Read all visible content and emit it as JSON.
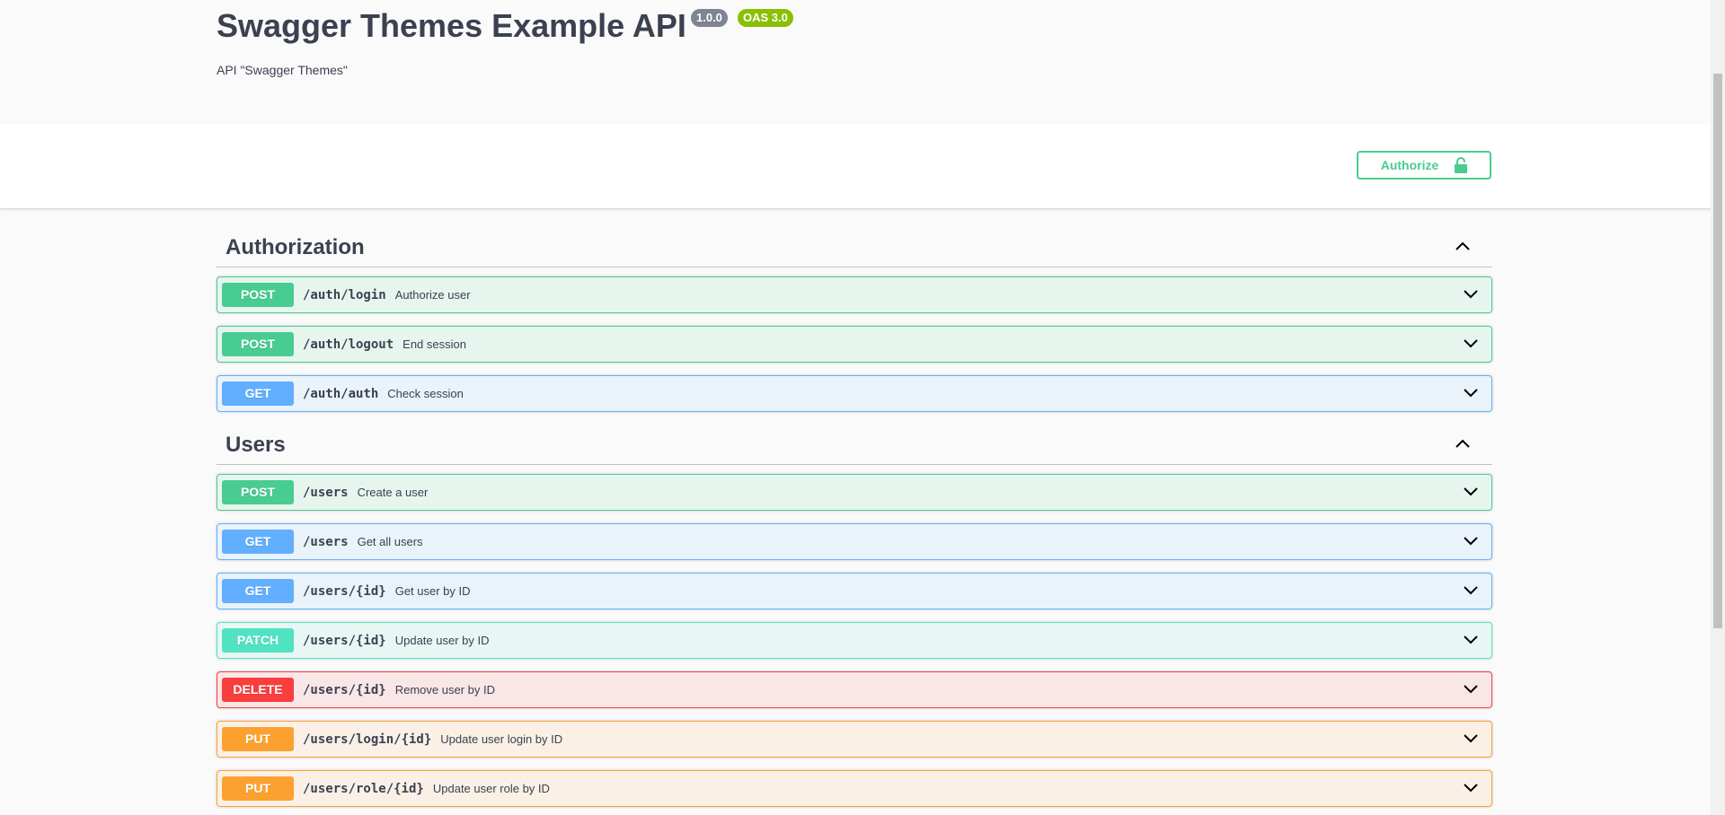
{
  "info": {
    "title": "Swagger Themes Example API",
    "version_badge": "1.0.0",
    "oas_badge": "OAS 3.0",
    "description": "API \"Swagger Themes\""
  },
  "authorize": {
    "label": "Authorize",
    "icon": "lock-icon"
  },
  "tags": [
    {
      "name": "Authorization",
      "operations": [
        {
          "method": "POST",
          "path": "/auth/login",
          "summary": "Authorize user"
        },
        {
          "method": "POST",
          "path": "/auth/logout",
          "summary": "End session"
        },
        {
          "method": "GET",
          "path": "/auth/auth",
          "summary": "Check session"
        }
      ]
    },
    {
      "name": "Users",
      "operations": [
        {
          "method": "POST",
          "path": "/users",
          "summary": "Create a user"
        },
        {
          "method": "GET",
          "path": "/users",
          "summary": "Get all users"
        },
        {
          "method": "GET",
          "path": "/users/{id}",
          "summary": "Get user by ID"
        },
        {
          "method": "PATCH",
          "path": "/users/{id}",
          "summary": "Update user by ID"
        },
        {
          "method": "DELETE",
          "path": "/users/{id}",
          "summary": "Remove user by ID"
        },
        {
          "method": "PUT",
          "path": "/users/login/{id}",
          "summary": "Update user login by ID"
        },
        {
          "method": "PUT",
          "path": "/users/role/{id}",
          "summary": "Update user role by ID"
        }
      ]
    }
  ],
  "colors": {
    "post": "#49cc90",
    "get": "#61affe",
    "patch": "#50e3c2",
    "delete": "#f93e3e",
    "put": "#fca130",
    "oas_badge": "#89bf04",
    "version_badge": "#7d8492"
  }
}
